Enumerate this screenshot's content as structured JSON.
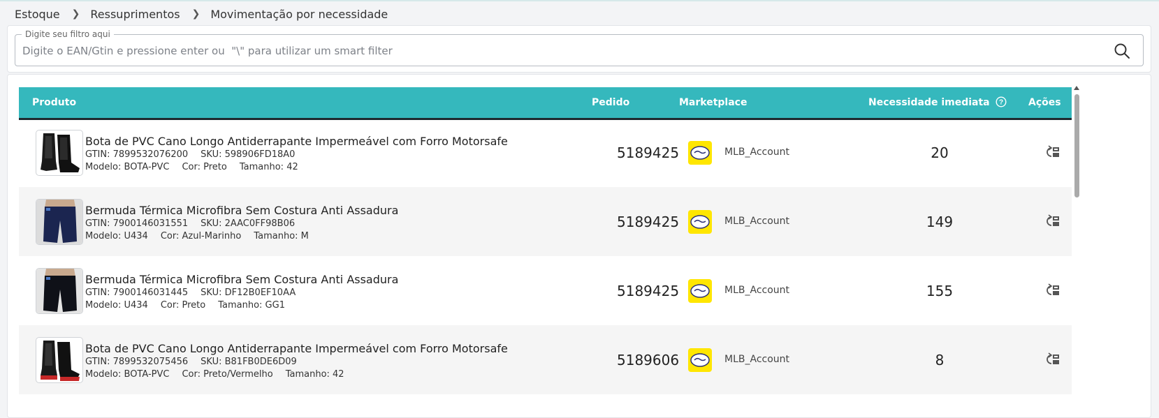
{
  "breadcrumb": [
    "Estoque",
    "Ressuprimentos",
    "Movimentação por necessidade"
  ],
  "filter": {
    "label": "Digite seu filtro aqui",
    "placeholder": "Digite o EAN/Gtin e pressione enter ou  \"\\\" para utilizar um smart filter"
  },
  "table": {
    "headers": {
      "product": "Produto",
      "order": "Pedido",
      "marketplace": "Marketplace",
      "need": "Necessidade imediata",
      "actions": "Ações"
    },
    "rows": [
      {
        "name": "Bota de PVC Cano Longo Antiderrapante Impermeável com Forro Motorsafe",
        "gtin": "GTIN: 7899532076200",
        "sku": "SKU: 598906FD18A0",
        "model": "Modelo: BOTA-PVC",
        "color": "Cor: Preto",
        "size": "Tamanho: 42",
        "order": "5189425",
        "marketplace": "MLB_Account",
        "need": "20",
        "image": "boot-black"
      },
      {
        "name": "Bermuda Térmica Microfibra Sem Costura Anti Assadura",
        "gtin": "GTIN: 7900146031551",
        "sku": "SKU: 2AAC0FF98B06",
        "model": "Modelo: U434",
        "color": "Cor: Azul-Marinho",
        "size": "Tamanho: M",
        "order": "5189425",
        "marketplace": "MLB_Account",
        "need": "149",
        "image": "shorts-navy"
      },
      {
        "name": "Bermuda Térmica Microfibra Sem Costura Anti Assadura",
        "gtin": "GTIN: 7900146031445",
        "sku": "SKU: DF12B0EF10AA",
        "model": "Modelo: U434",
        "color": "Cor: Preto",
        "size": "Tamanho: GG1",
        "order": "5189425",
        "marketplace": "MLB_Account",
        "need": "155",
        "image": "shorts-black"
      },
      {
        "name": "Bota de PVC Cano Longo Antiderrapante Impermeável com Forro Motorsafe",
        "gtin": "GTIN: 7899532075456",
        "sku": "SKU: B81FB0DE6D09",
        "model": "Modelo: BOTA-PVC",
        "color": "Cor: Preto/Vermelho",
        "size": "Tamanho: 42",
        "order": "5189606",
        "marketplace": "MLB_Account",
        "need": "8",
        "image": "boot-black-red"
      }
    ]
  },
  "colors": {
    "header": "#35b8bd",
    "marketplace_logo": "#ffe600"
  }
}
